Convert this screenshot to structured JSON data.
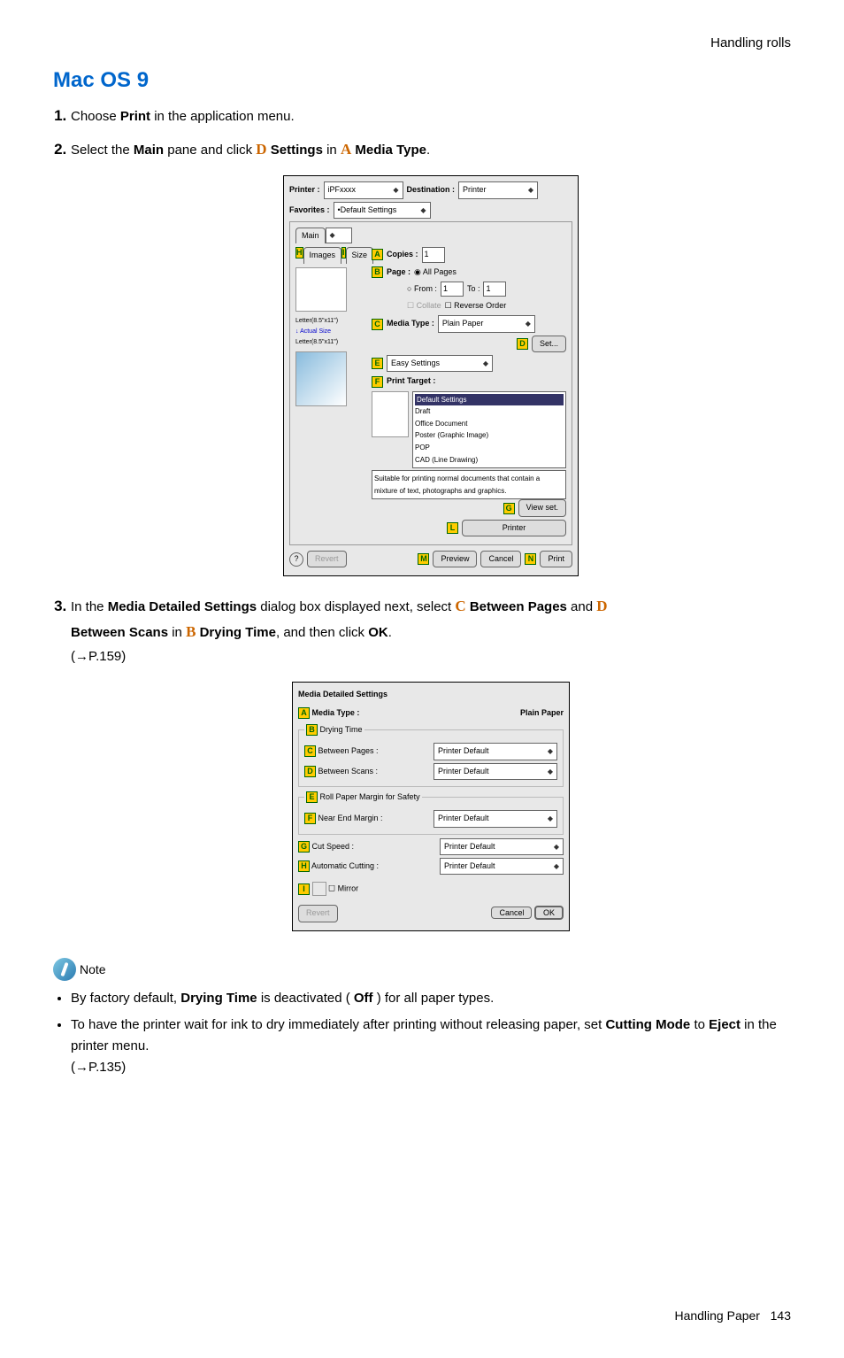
{
  "header": {
    "section": "Handling rolls"
  },
  "title": "Mac OS 9",
  "steps": {
    "s1": {
      "pre": "Choose ",
      "b1": "Print",
      "post": " in the application menu."
    },
    "s2": {
      "pre": "Select the ",
      "b1": "Main",
      "mid1": " pane and click ",
      "l1": "D",
      "b2": " Settings",
      "mid2": " in ",
      "l2": "A",
      "b3": " Media Type",
      "end": "."
    },
    "s3": {
      "pre": "In the ",
      "b1": "Media Detailed Settings",
      "mid1": " dialog box displayed next, select ",
      "l1": "C",
      "b2": " Between Pages",
      "mid2": " and ",
      "l2": "D",
      "b3": "Between Scans",
      "mid3": " in ",
      "l3": "B",
      "b4": " Drying Time",
      "mid4": ", and then click ",
      "b5": "OK",
      "end": ".",
      "ref": "(→P.159)"
    }
  },
  "dialog1": {
    "printer_lbl": "Printer :",
    "printer_val": "iPFxxxx",
    "dest_lbl": "Destination :",
    "dest_val": "Printer",
    "fav_lbl": "Favorites :",
    "fav_val": "Default Settings",
    "tab_main": "Main",
    "tab_images": "Images",
    "tab_size": "Size",
    "copies_lbl": "Copies :",
    "copies_val": "1",
    "page_lbl": "Page :",
    "allpages": "All Pages",
    "from": "From :",
    "from_v": "1",
    "to": "To :",
    "to_v": "1",
    "collate": "Collate",
    "reverse": "Reverse Order",
    "media_lbl": "Media Type :",
    "media_val": "Plain Paper",
    "set_btn": "Set...",
    "paper1": "Letter(8.5\"x11\")",
    "actual": "Actual Size",
    "paper2": "Letter(8.5\"x11\")",
    "easy": "Easy Settings",
    "target_lbl": "Print Target :",
    "targets": [
      "Default Settings",
      "Draft",
      "Office Document",
      "Poster (Graphic Image)",
      "POP",
      "CAD (Line Drawing)"
    ],
    "desc": "Suitable for printing normal documents that contain a mixture of text, photographs and graphics.",
    "viewset": "View set.",
    "printer_btn": "Printer",
    "revert": "Revert",
    "preview": "Preview",
    "cancel": "Cancel",
    "print": "Print",
    "mH": "H",
    "mI": "I",
    "mA": "A",
    "mB": "B",
    "mC": "C",
    "mD": "D",
    "mE": "E",
    "mF": "F",
    "mG": "G",
    "mL": "L",
    "mM": "M",
    "mN": "N"
  },
  "dialog2": {
    "title": "Media Detailed Settings",
    "media_lbl": "Media Type :",
    "media_val": "Plain Paper",
    "grp_dry": "Drying Time",
    "between_pages": "Between Pages :",
    "between_scans": "Between Scans :",
    "grp_roll": "Roll Paper Margin for Safety",
    "near_end": "Near End Margin :",
    "cut_speed": "Cut Speed :",
    "auto_cut": "Automatic Cutting :",
    "default": "Printer Default",
    "mirror": "Mirror",
    "revert": "Revert",
    "cancel": "Cancel",
    "ok": "OK",
    "mA": "A",
    "mB": "B",
    "mC": "C",
    "mD": "D",
    "mE": "E",
    "mF": "F",
    "mG": "G",
    "mH": "H",
    "mI": "I"
  },
  "note": {
    "label": "Note",
    "n1a": "By factory default, ",
    "n1b": "Drying Time",
    "n1c": " is deactivated ( ",
    "n1d": "Off",
    "n1e": " ) for all paper types.",
    "n2a": "To have the printer wait for ink to dry immediately after printing without releasing paper, set ",
    "n2b": "Cutting Mode",
    "n2c": " to ",
    "n2d": "Eject",
    "n2e": " in the printer menu.",
    "n2ref": "(→P.135)"
  },
  "footer": {
    "text": "Handling Paper",
    "page": "143"
  }
}
